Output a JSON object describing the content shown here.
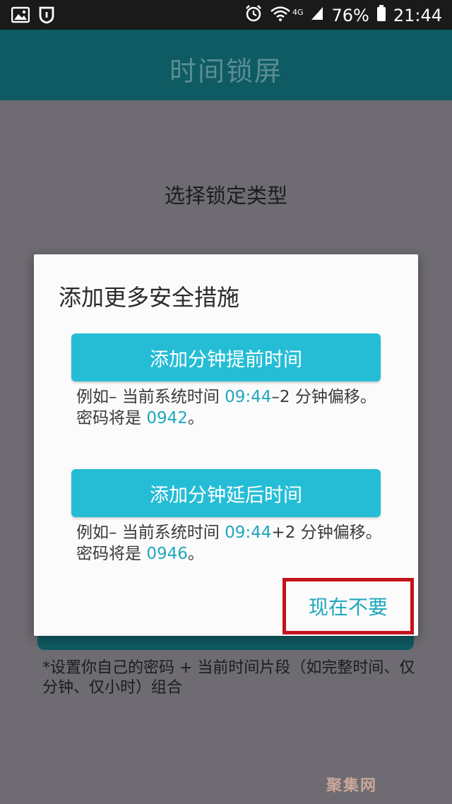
{
  "status_bar": {
    "network": "4G",
    "battery_percent": "76%",
    "time": "21:44",
    "icons": [
      "image-icon",
      "shield-icon",
      "alarm-icon",
      "wifi-icon",
      "signal-icon",
      "battery-icon"
    ]
  },
  "app_bar": {
    "title": "时间锁屏"
  },
  "main": {
    "section_title": "选择锁定类型",
    "footnote": "*设置你自己的密码 + 当前时间片段（如完整时间、仅分钟、仅小时）组合"
  },
  "dialog": {
    "title": "添加更多安全措施",
    "option1": {
      "button": "添加分钟提前时间",
      "ex_prefix": "例如– 当前系统时间 ",
      "ex_time": "09:44",
      "ex_mid": "–2 分钟偏移。密码将是 ",
      "ex_code": "0942",
      "ex_end": "。"
    },
    "option2": {
      "button": "添加分钟延后时间",
      "ex_prefix": "例如– 当前系统时间 ",
      "ex_time": "09:44",
      "ex_mid": "+2 分钟偏移。密码将是 ",
      "ex_code": "0946",
      "ex_end": "。"
    },
    "not_now": "现在不要"
  },
  "watermark": "聚集网",
  "colors": {
    "accent": "#25bdd6",
    "highlight_text": "#1fa8bf",
    "app_bar": "#0f5b63",
    "annotation_box": "#c3121c"
  }
}
